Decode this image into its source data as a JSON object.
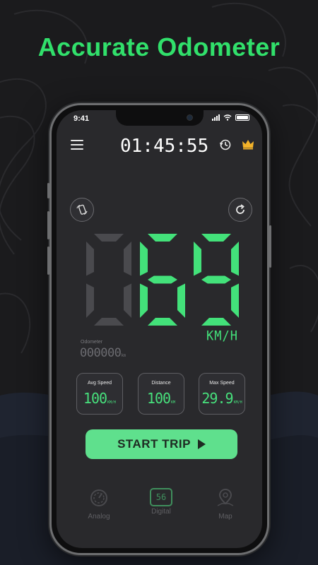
{
  "promo": {
    "title": "Accurate Odometer"
  },
  "status_bar": {
    "time": "9:41"
  },
  "header": {
    "trip_time": "01:45:55",
    "icons": [
      "menu-icon",
      "history-icon",
      "crown-icon"
    ]
  },
  "speedometer": {
    "digits": [
      "0",
      "6",
      "9"
    ],
    "active_digits": [
      false,
      true,
      true
    ],
    "unit": "KM/H",
    "controls": [
      "rotate-screen-icon",
      "reset-icon"
    ]
  },
  "odometer": {
    "label": "Odometer",
    "value": "000000",
    "unit": "km"
  },
  "stats": [
    {
      "label": "Avg Speed",
      "value": "100",
      "unit": "KM/H"
    },
    {
      "label": "Distance",
      "value": "100",
      "unit": "KM"
    },
    {
      "label": "Max Speed",
      "value": "29.9",
      "unit": "KM/H"
    }
  ],
  "start_button": {
    "label": "START TRIP"
  },
  "bottom_nav": [
    {
      "label": "Analog",
      "icon": "gauge-icon",
      "active": false
    },
    {
      "label": "Digital",
      "icon": "digital-display-icon",
      "badge": "56",
      "active": true
    },
    {
      "label": "Map",
      "icon": "map-pin-icon",
      "active": false
    }
  ],
  "colors": {
    "accent_green": "#31e06b",
    "digit_green": "#43e17a",
    "inactive_digit": "#4a4a4e",
    "button_green": "#5fe08d",
    "screen_bg": "#29292c",
    "page_bg": "#1b1b1d"
  }
}
